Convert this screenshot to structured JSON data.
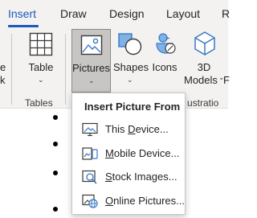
{
  "tabs": [
    {
      "label": "Insert",
      "active": true
    },
    {
      "label": "Draw",
      "active": false
    },
    {
      "label": "Design",
      "active": false
    },
    {
      "label": "Layout",
      "active": false
    },
    {
      "label": "R",
      "active": false
    }
  ],
  "ribbon": {
    "left_fragment_line1": "e",
    "left_fragment_line2": "k",
    "table": {
      "label": "Table",
      "group_label": "Tables"
    },
    "pictures": {
      "label": "Pictures"
    },
    "shapes": {
      "label": "Shapes"
    },
    "icons": {
      "label": "Icons"
    },
    "models3d": {
      "label_line1": "3D",
      "label_line2": "Models",
      "overflow": "F"
    },
    "illustrations_fragment": "ustratio"
  },
  "menu": {
    "header": "Insert Picture From",
    "items": [
      {
        "label": "This Device...",
        "mnemonic_index": 5,
        "icon": "this-device-icon"
      },
      {
        "label": "Mobile Device...",
        "mnemonic_index": 0,
        "icon": "mobile-device-icon"
      },
      {
        "label": "Stock Images...",
        "mnemonic_index": 0,
        "icon": "stock-images-icon"
      },
      {
        "label": "Online Pictures...",
        "mnemonic_index": 0,
        "icon": "online-pictures-icon"
      }
    ]
  },
  "colors": {
    "accent": "#185abd",
    "ribbon_bg": "#f3f2f1",
    "selected_bg": "#c8c6c4",
    "icon_blue": "#3a78c4",
    "icon_light": "#7fb3e6"
  }
}
